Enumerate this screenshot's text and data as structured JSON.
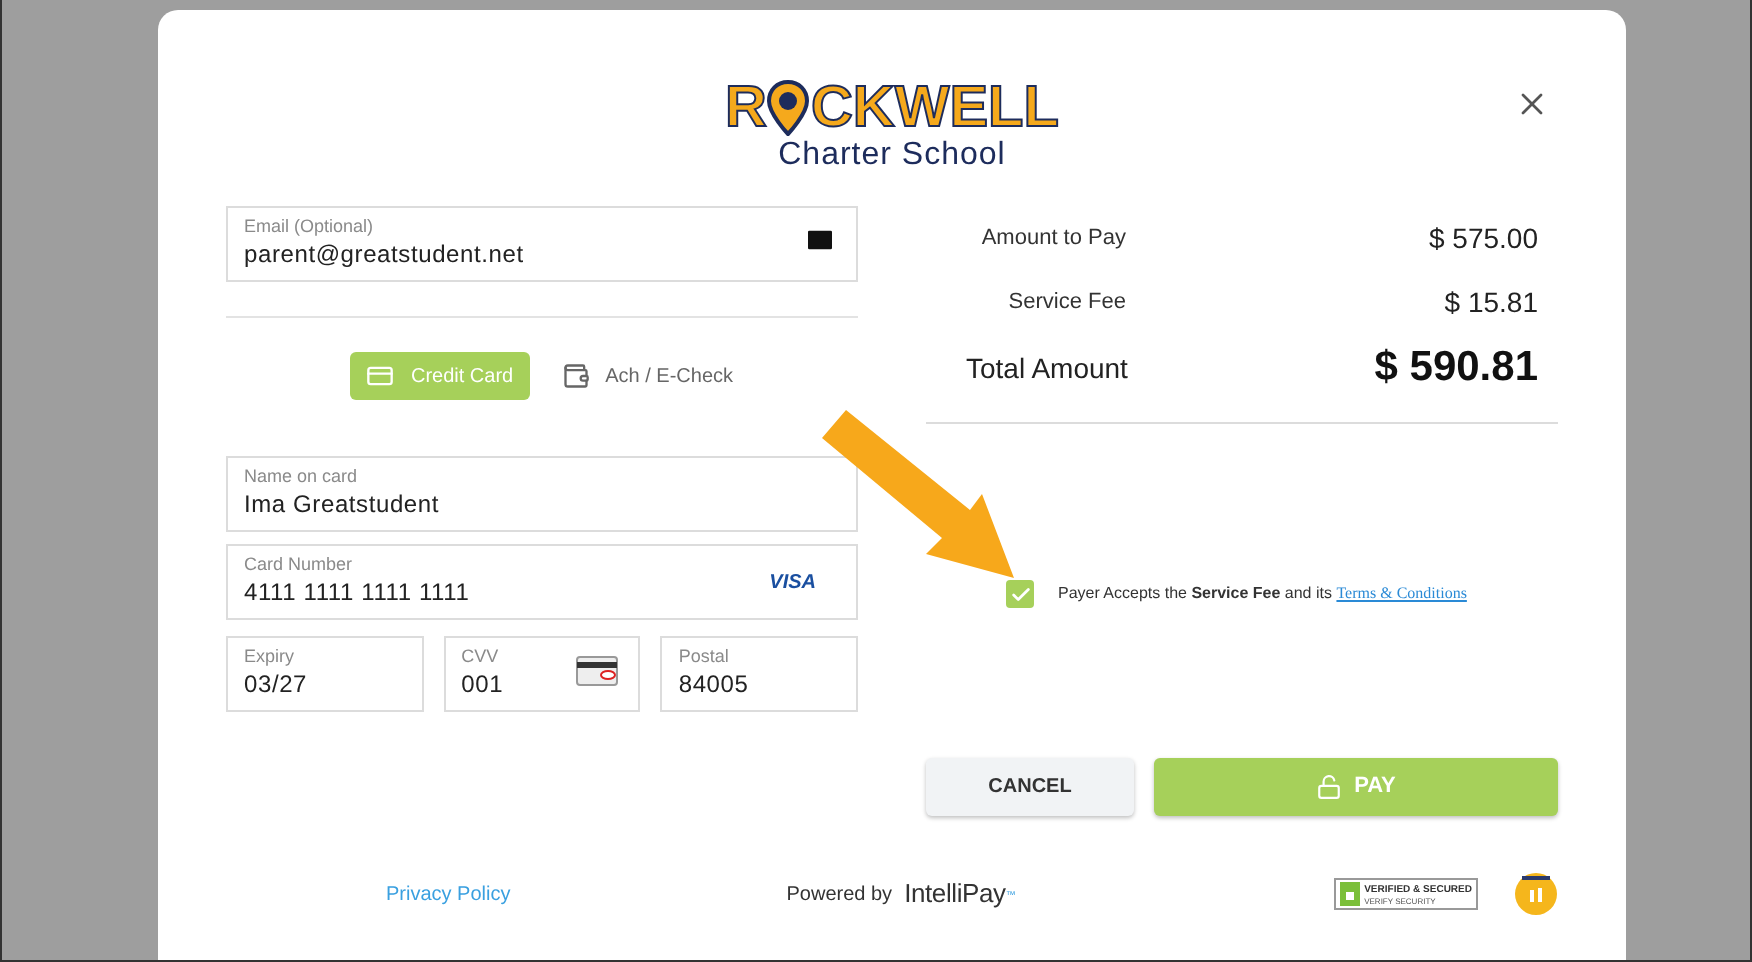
{
  "logo": {
    "before_pin": "R",
    "after_pin": "CKWELL",
    "subtitle": "Charter School"
  },
  "email": {
    "label": "Email (Optional)",
    "value": "parent@greatstudent.net"
  },
  "payment_methods": [
    {
      "label": "Credit Card",
      "selected": true,
      "kind": "card"
    },
    {
      "label": "Ach / E-Check",
      "selected": false,
      "kind": "check"
    }
  ],
  "card_fields": [
    {
      "label": "Name on card",
      "value": "Ima Greatstudent",
      "kind": "text"
    },
    {
      "label": "Card Number",
      "value": "4111 1111 1111 1111",
      "kind": "card_number",
      "brand": "VISA"
    }
  ],
  "small_fields": [
    {
      "label": "Expiry",
      "value": "03/27",
      "kind": "text"
    },
    {
      "label": "CVV",
      "value": "001",
      "kind": "cvv"
    },
    {
      "label": "Postal",
      "value": "84005",
      "kind": "text"
    }
  ],
  "summary": [
    {
      "label": "Amount to Pay",
      "value": "$ 575.00",
      "kind": "line"
    },
    {
      "label": "Service Fee",
      "value": "$ 15.81",
      "kind": "line"
    },
    {
      "label": "Total Amount",
      "value": "$ 590.81",
      "kind": "total"
    }
  ],
  "agreement": {
    "checked": true,
    "text": "Payer Accepts the **Service Fee** and its",
    "link": "Terms & Conditions"
  },
  "buttons": [
    {
      "label": "CANCEL",
      "kind": "secondary"
    },
    {
      "label": "PAY",
      "kind": "primary"
    }
  ],
  "footer": {
    "privacy": "Privacy Policy",
    "powered_by": "Powered by",
    "brand": "IntelliPay",
    "brand_mark": "™"
  },
  "security_badge": {
    "line1": "VERIFIED & SECURED",
    "line2": "VERIFY SECURITY"
  }
}
